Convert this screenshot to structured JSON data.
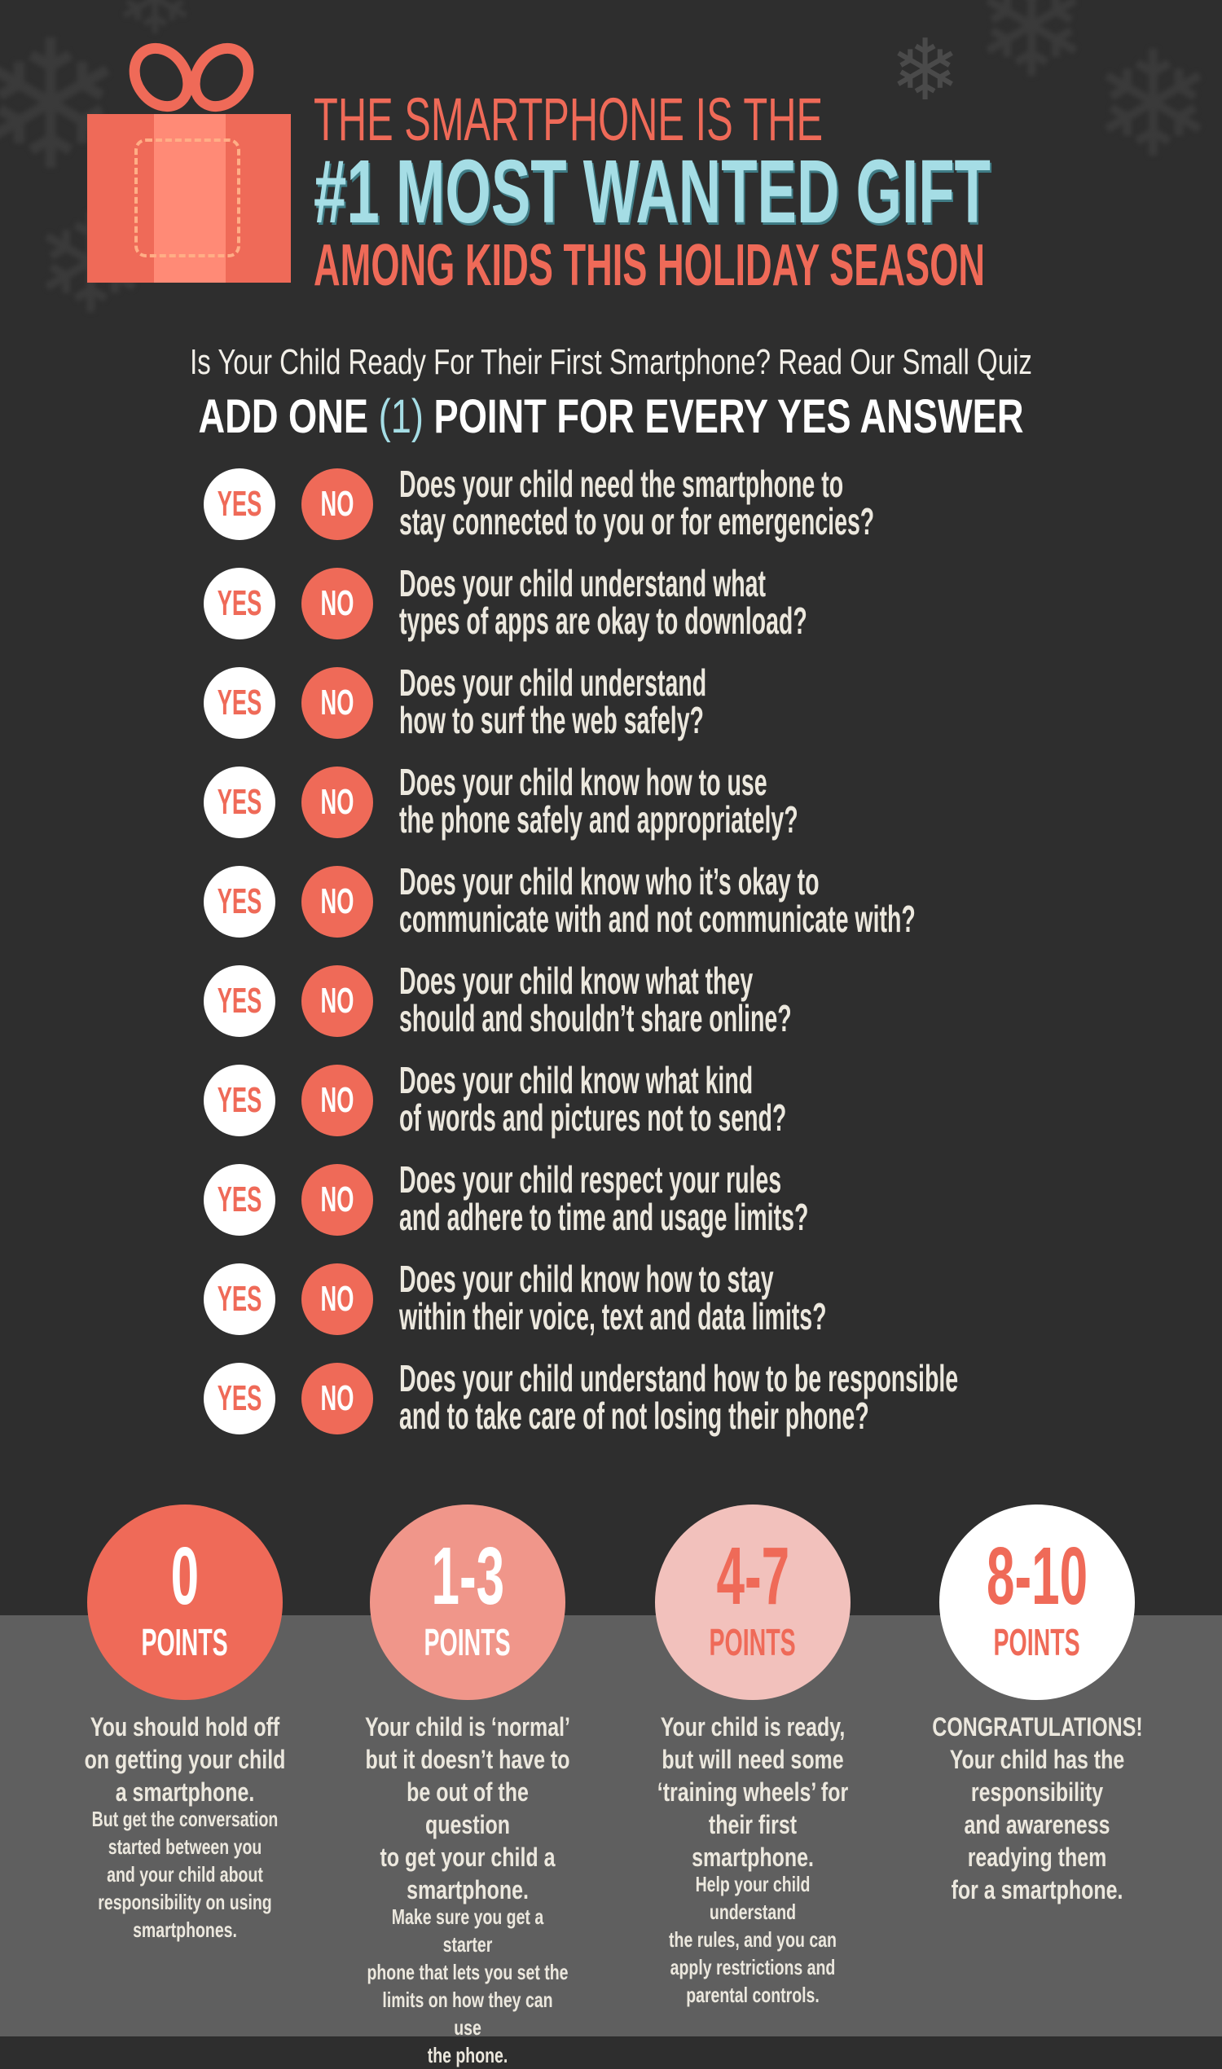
{
  "header": {
    "line1": "THE SMARTPHONE IS THE",
    "line2": "#1 MOST WANTED GIFT",
    "line3": "AMONG KIDS THIS HOLIDAY SEASON"
  },
  "intro": {
    "subtitle": "Is Your Child Ready For Their First Smartphone? Read Our Small Quiz",
    "instruction_pre": "ADD ONE ",
    "instruction_highlight": "(1)",
    "instruction_post": " POINT FOR EVERY YES ANSWER"
  },
  "quiz": {
    "yes_label": "YES",
    "no_label": "NO",
    "questions": [
      {
        "line1": "Does your child need the smartphone to",
        "line2": "stay connected to you or for emergencies?"
      },
      {
        "line1": "Does your child understand what",
        "line2": "types of apps are okay to download?"
      },
      {
        "line1": "Does your child understand",
        "line2": "how to surf the web safely?"
      },
      {
        "line1": "Does your child know how to use",
        "line2": "the phone safely and appropriately?"
      },
      {
        "line1": "Does your child know who it’s okay to",
        "line2": "communicate with and not communicate with?"
      },
      {
        "line1": "Does your child know what they",
        "line2": "should and shouldn’t share online?"
      },
      {
        "line1": "Does your child know what kind",
        "line2": "of words and pictures not to send?"
      },
      {
        "line1": "Does your child respect your rules",
        "line2": "and adhere to time and usage limits?"
      },
      {
        "line1": "Does your child know how to stay",
        "line2": "within their voice, text and data limits?"
      },
      {
        "line1": "Does your child understand how to be responsible",
        "line2": "and to take care of not losing their phone?"
      }
    ]
  },
  "results": [
    {
      "range": "0",
      "unit": "POINTS",
      "circle_color": "#ef6a58",
      "text_color": "#ffffff",
      "main": "You should hold off\non getting your child\na smartphone.",
      "extra": "But get the conversation\nstarted between you\nand your child about\nresponsibility on using\nsmartphones."
    },
    {
      "range": "1-3",
      "unit": "POINTS",
      "circle_color": "#f0968a",
      "text_color": "#ffffff",
      "main": "Your child is ‘normal’\nbut it doesn’t have to\nbe out of the question\nto get your child a\nsmartphone.",
      "extra": "Make sure you get a starter\nphone that lets you set the\nlimits on how they can use\nthe phone."
    },
    {
      "range": "4-7",
      "unit": "POINTS",
      "circle_color": "#f2c1bc",
      "text_color": "#ef6a58",
      "main": "Your child is ready,\nbut will need some\n‘training wheels’ for\ntheir first smartphone.",
      "extra": "Help your child understand\nthe rules, and you can\napply restrictions and\nparental controls."
    },
    {
      "range": "8-10",
      "unit": "POINTS",
      "circle_color": "#ffffff",
      "text_color": "#ef6a58",
      "main": "CONGRATULATIONS!\nYour child has the\nresponsibility\nand awareness\nreadying them\nfor a smartphone.",
      "extra": ""
    }
  ],
  "colors": {
    "background": "#2e2e2e",
    "band": "#5f5f5f",
    "coral": "#ef6a58",
    "light_blue": "#a5dde5",
    "text_light": "#ece8de"
  }
}
